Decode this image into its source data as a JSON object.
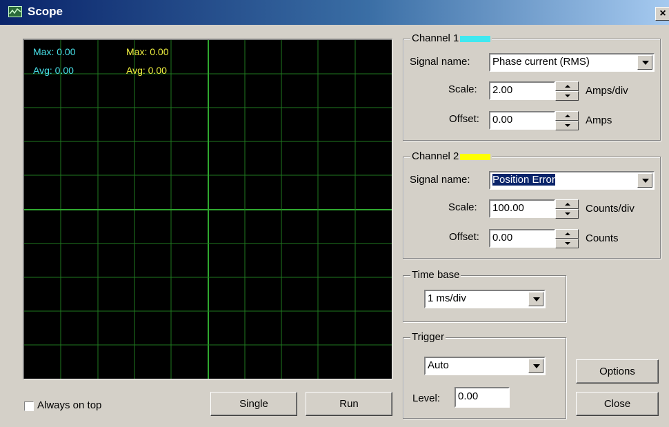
{
  "window": {
    "title": "Scope",
    "icon": "scope-icon",
    "close_glyph": "×"
  },
  "scope": {
    "ch1": {
      "max": "Max: 0.00",
      "avg": "Avg: 0.00",
      "color": "#48e0e8"
    },
    "ch2": {
      "max": "Max: 0.00",
      "avg": "Avg: 0.00",
      "color": "#f0f040"
    },
    "grid_color": "#1f7a1f",
    "axis_color": "#2fa82f",
    "background": "#000000"
  },
  "options": {
    "always_on_top_label": "Always on top",
    "always_on_top_checked": false
  },
  "buttons": {
    "single": "Single",
    "run": "Run",
    "options": "Options",
    "close": "Close"
  },
  "channel1": {
    "title": "Channel 1",
    "swatch_color": "#40e8f0",
    "signal_label": "Signal name:",
    "signal_value": "Phase current (RMS)",
    "scale_label": "Scale:",
    "scale_value": "2.00",
    "scale_unit": "Amps/div",
    "offset_label": "Offset:",
    "offset_value": "0.00",
    "offset_unit": "Amps"
  },
  "channel2": {
    "title": "Channel 2",
    "swatch_color": "#ffff00",
    "signal_label": "Signal name:",
    "signal_value": "Position Error",
    "scale_label": "Scale:",
    "scale_value": "100.00",
    "scale_unit": "Counts/div",
    "offset_label": "Offset:",
    "offset_value": "0.00",
    "offset_unit": "Counts"
  },
  "timebase": {
    "title": "Time base",
    "value": "1 ms/div"
  },
  "trigger": {
    "title": "Trigger",
    "mode": "Auto",
    "level_label": "Level:",
    "level_value": "0.00"
  }
}
